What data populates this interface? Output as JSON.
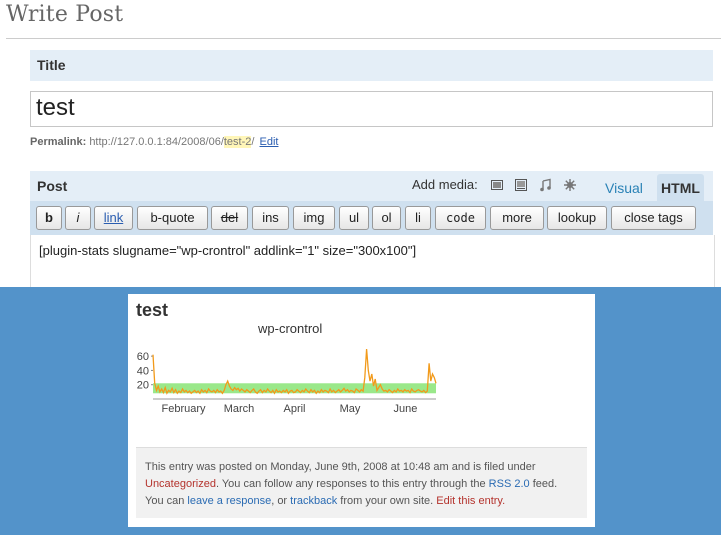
{
  "page": {
    "title": "Write Post"
  },
  "title_section": {
    "label": "Title",
    "value": "test"
  },
  "permalink": {
    "label": "Permalink:",
    "base": "http://127.0.0.1:84/2008/06/",
    "slug": "test-2",
    "trailing": "/",
    "edit_label": "Edit"
  },
  "post_section": {
    "label": "Post",
    "add_media_label": "Add media:",
    "media_icons": [
      "image-icon",
      "video-icon",
      "audio-icon",
      "media-icon"
    ],
    "tabs": {
      "visual": "Visual",
      "html": "HTML"
    },
    "active_tab": "HTML"
  },
  "toolbar": {
    "buttons": [
      "b",
      "i",
      "link",
      "b-quote",
      "del",
      "ins",
      "img",
      "ul",
      "ol",
      "li",
      "code",
      "more",
      "lookup",
      "close tags"
    ]
  },
  "editor": {
    "content": "[plugin-stats slugname=\"wp-crontrol\" addlink=\"1\" size=\"300x100\"]"
  },
  "preview": {
    "post_title": "test",
    "meta_lines": {
      "l1": "This entry was posted on Monday, June 9th, 2008 at 10:48 am and is filed under",
      "category": "Uncategorized",
      "l2_mid": ". You can follow any responses to this entry through the ",
      "rss": "RSS 2.0",
      "l2_end": " feed.",
      "l3_start": "You can ",
      "leave_response": "leave a response",
      "l3_mid": ", or ",
      "trackback": "trackback",
      "l3_mid2": " from your own site. ",
      "edit_entry": "Edit this entry."
    }
  },
  "chart_data": {
    "type": "line",
    "title": "wp-crontrol",
    "yticks": [
      20,
      40,
      60
    ],
    "ylim": [
      0,
      70
    ],
    "xticks": [
      "February",
      "March",
      "April",
      "May",
      "June"
    ],
    "band": {
      "low": 8,
      "high": 22,
      "color": "#9ae88a"
    },
    "line_color": "#f29a1a",
    "series": [
      {
        "values": [
          62,
          22,
          12,
          18,
          10,
          14,
          9,
          16,
          8,
          12,
          10,
          15,
          9,
          13,
          8,
          11,
          9,
          14,
          10,
          12,
          9,
          11,
          8,
          10,
          12,
          9,
          11,
          8,
          13,
          10,
          12,
          9,
          14,
          11,
          10,
          12,
          9,
          13,
          10,
          11,
          8,
          12,
          20,
          25,
          18,
          14,
          12,
          16,
          13,
          15,
          11,
          14,
          12,
          10,
          13,
          11,
          9,
          12,
          14,
          10,
          8,
          11,
          13,
          9,
          12,
          10,
          14,
          11,
          9,
          12,
          8,
          13,
          10,
          11,
          9,
          12,
          10,
          13,
          8,
          11,
          12,
          9,
          10,
          13,
          11,
          9,
          12,
          10,
          14,
          11,
          9,
          13,
          10,
          12,
          8,
          11,
          9,
          13,
          10,
          12,
          11,
          9,
          14,
          10,
          12,
          9,
          11,
          13,
          10,
          12,
          15,
          11,
          13,
          10,
          12,
          11,
          9,
          14,
          12,
          10,
          13,
          11,
          30,
          70,
          40,
          25,
          35,
          18,
          28,
          12,
          16,
          20,
          14,
          11,
          12,
          10,
          13,
          11,
          9,
          12,
          10,
          14,
          11,
          12,
          10,
          13,
          11,
          12,
          9,
          14,
          11,
          10,
          12,
          13,
          11,
          10,
          12,
          9,
          11,
          50,
          25,
          35,
          30,
          22
        ]
      }
    ]
  }
}
